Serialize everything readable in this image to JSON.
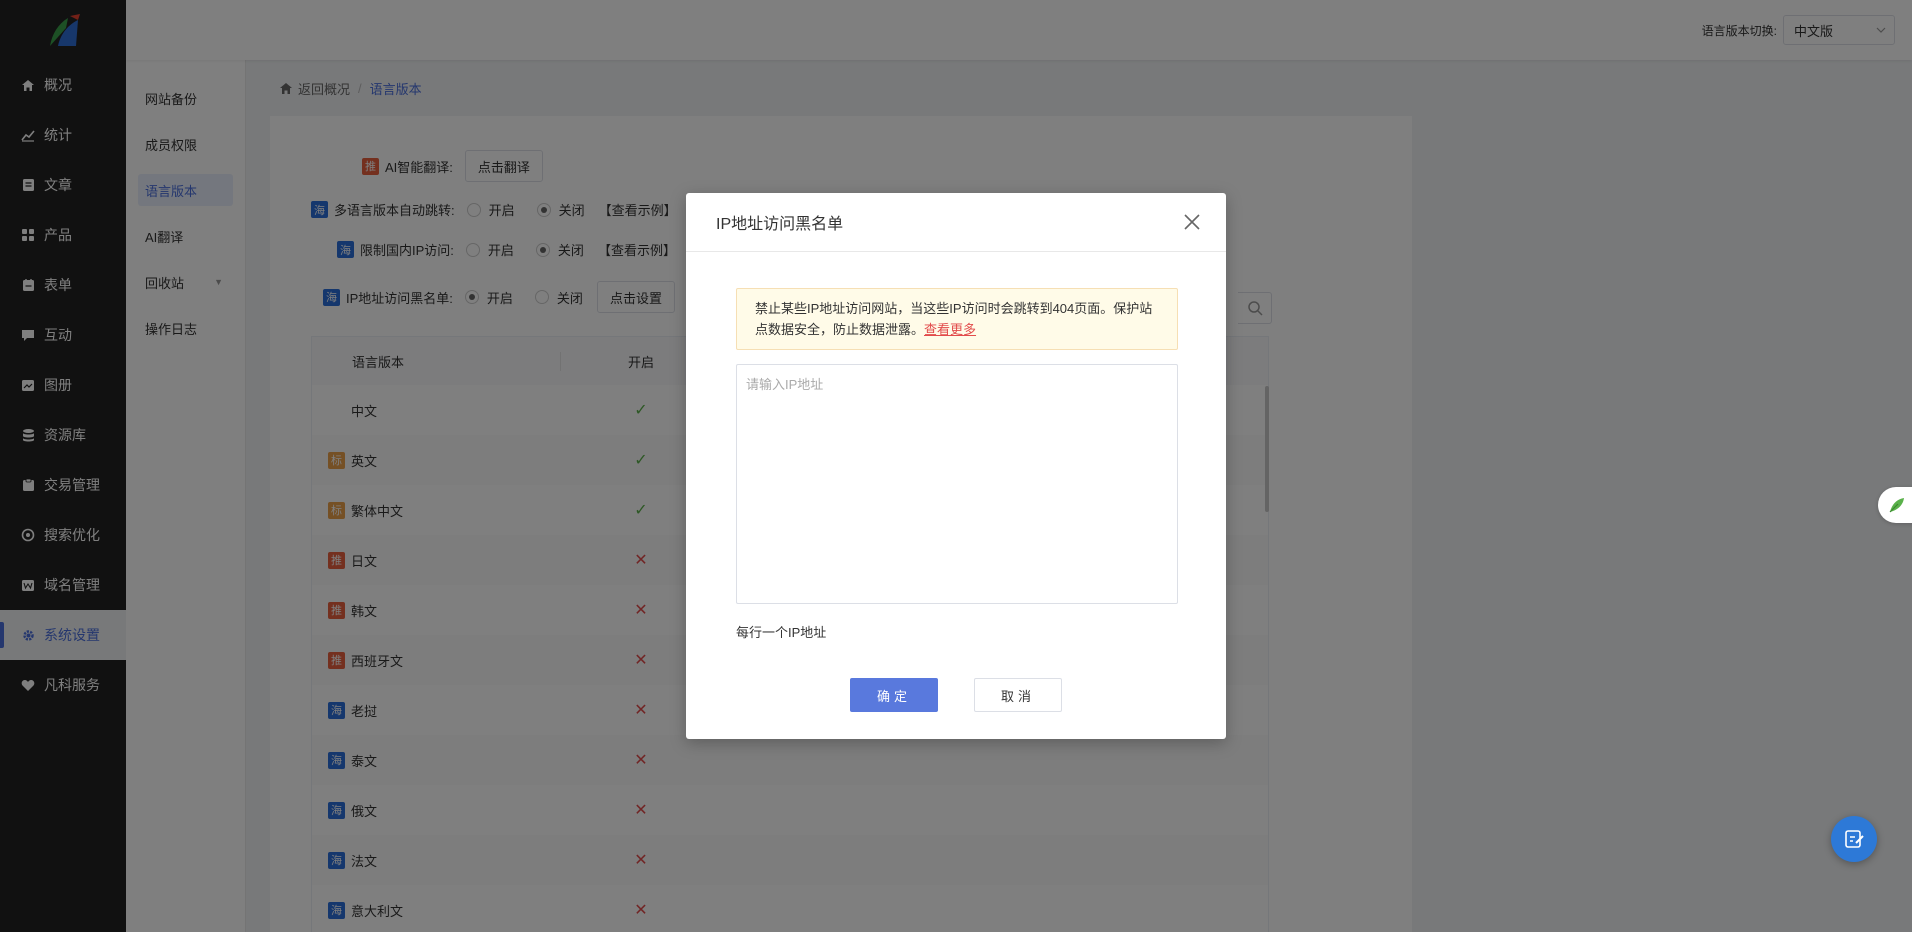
{
  "topbar": {
    "lang_label": "语言版本切换:",
    "lang_value": "中文版"
  },
  "nav": {
    "items": [
      {
        "label": "概况",
        "icon": "home-icon"
      },
      {
        "label": "统计",
        "icon": "chart-icon"
      },
      {
        "label": "文章",
        "icon": "article-icon"
      },
      {
        "label": "产品",
        "icon": "grid-icon"
      },
      {
        "label": "表单",
        "icon": "form-icon"
      },
      {
        "label": "互动",
        "icon": "chat-icon"
      },
      {
        "label": "图册",
        "icon": "album-icon"
      },
      {
        "label": "资源库",
        "icon": "database-icon"
      },
      {
        "label": "交易管理",
        "icon": "trade-icon"
      },
      {
        "label": "搜索优化",
        "icon": "seo-icon"
      },
      {
        "label": "域名管理",
        "icon": "domain-icon"
      },
      {
        "label": "系统设置",
        "icon": "gear-icon"
      },
      {
        "label": "凡科服务",
        "icon": "heart-icon"
      }
    ]
  },
  "subnav": {
    "items": [
      {
        "label": "网站备份"
      },
      {
        "label": "成员权限"
      },
      {
        "label": "语言版本"
      },
      {
        "label": "AI翻译"
      },
      {
        "label": "回收站"
      },
      {
        "label": "操作日志"
      }
    ]
  },
  "breadcrumb": {
    "back": "返回概况",
    "sep": "/",
    "current": "语言版本"
  },
  "settings": {
    "ai_tag": "推",
    "ai_label": "AI智能翻译:",
    "ai_button": "点击翻译",
    "auto_tag": "海",
    "auto_label": "多语言版本自动跳转:",
    "ipcn_tag": "海",
    "ipcn_label": "限制国内IP访问:",
    "black_tag": "海",
    "black_label": "IP地址访问黑名单:",
    "on": "开启",
    "off": "关闭",
    "example": "【查看示例】",
    "setup_button": "点击设置"
  },
  "table": {
    "headers": [
      "语言版本",
      "开启"
    ],
    "rows": [
      {
        "tag": "",
        "name": "中文",
        "enabled": "✓"
      },
      {
        "tag": "标",
        "name": "英文",
        "enabled": "✓"
      },
      {
        "tag": "标",
        "name": "繁体中文",
        "enabled": "✓"
      },
      {
        "tag": "推",
        "name": "日文",
        "enabled": "✕"
      },
      {
        "tag": "推",
        "name": "韩文",
        "enabled": "✕"
      },
      {
        "tag": "推",
        "name": "西班牙文",
        "enabled": "✕"
      },
      {
        "tag": "海",
        "name": "老挝",
        "enabled": "✕"
      },
      {
        "tag": "海",
        "name": "泰文",
        "enabled": "✕"
      },
      {
        "tag": "海",
        "name": "俄文",
        "enabled": "✕"
      },
      {
        "tag": "海",
        "name": "法文",
        "enabled": "✕"
      },
      {
        "tag": "海",
        "name": "意大利文",
        "enabled": "✕"
      }
    ]
  },
  "modal": {
    "title": "IP地址访问黑名单",
    "notice": "禁止某些IP地址访问网站，当这些IP访问时会跳转到404页面。保护站点数据安全，防止数据泄露。",
    "notice_link": "查看更多",
    "placeholder": "请输入IP地址",
    "value": "",
    "hint": "每行一个IP地址",
    "confirm": "确定",
    "cancel": "取消"
  },
  "colors": {
    "accent": "#4b6fdc",
    "confirm": "#5979dd",
    "ok": "#5ab14a",
    "error": "#e24b4b",
    "nav_bg": "#232323"
  }
}
